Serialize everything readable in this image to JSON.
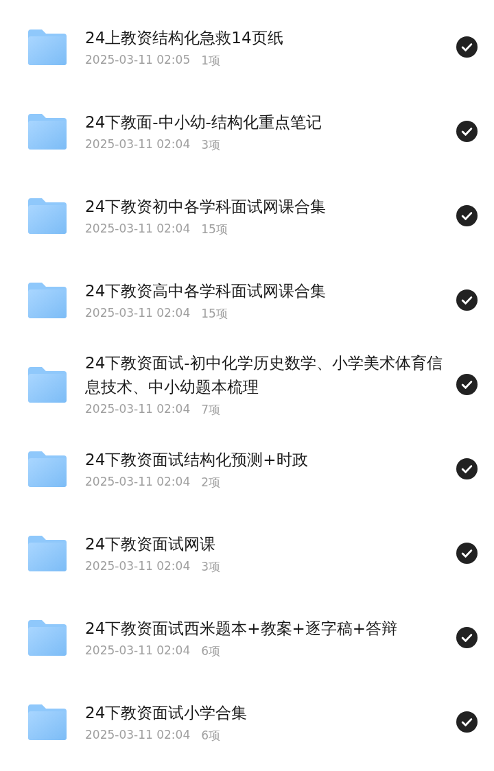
{
  "folders": [
    {
      "name": "24上教资结构化急救14页纸",
      "date": "2025-03-11 02:05",
      "count": "1项",
      "selected": true
    },
    {
      "name": "24下教面-中小幼-结构化重点笔记",
      "date": "2025-03-11 02:04",
      "count": "3项",
      "selected": true
    },
    {
      "name": "24下教资初中各学科面试网课合集",
      "date": "2025-03-11 02:04",
      "count": "15项",
      "selected": true
    },
    {
      "name": "24下教资高中各学科面试网课合集",
      "date": "2025-03-11 02:04",
      "count": "15项",
      "selected": true
    },
    {
      "name": "24下教资面试-初中化学历史数学、小学美术体育信息技术、中小幼题本梳理",
      "date": "2025-03-11 02:04",
      "count": "7项",
      "selected": true
    },
    {
      "name": "24下教资面试结构化预测+时政",
      "date": "2025-03-11 02:04",
      "count": "2项",
      "selected": true
    },
    {
      "name": "24下教资面试网课",
      "date": "2025-03-11 02:04",
      "count": "3项",
      "selected": true
    },
    {
      "name": "24下教资面试西米题本+教案+逐字稿+答辩",
      "date": "2025-03-11 02:04",
      "count": "6项",
      "selected": true
    },
    {
      "name": "24下教资面试小学合集",
      "date": "2025-03-11 02:04",
      "count": "6项",
      "selected": true
    }
  ]
}
